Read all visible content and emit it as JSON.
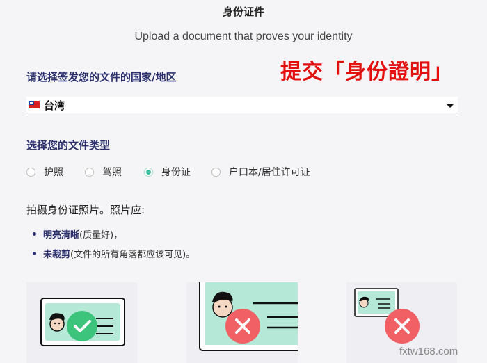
{
  "header": {
    "title": "身份证件",
    "subtitle": "Upload a document that proves your identity"
  },
  "annotation": "提交「身份證明」",
  "country": {
    "label": "请选择签发您的文件的国家/地区",
    "value": "台湾",
    "flag_icon": "taiwan-flag-icon"
  },
  "doc_type": {
    "label": "选择您的文件类型",
    "options": [
      "护照",
      "驾照",
      "身份证",
      "户口本/居住许可证"
    ],
    "selected": "身份证"
  },
  "photo_instructions": {
    "heading": "拍摄身份证照片。照片应:",
    "items": [
      {
        "bold": "明亮清晰",
        "rest": "(质量好)，"
      },
      {
        "bold": "未裁剪",
        "rest": "(文件的所有角落都应该可见)。"
      }
    ]
  },
  "examples": [
    {
      "status": "good",
      "icon": "check-icon"
    },
    {
      "status": "bad-cropped",
      "icon": "x-icon"
    },
    {
      "status": "bad-small",
      "icon": "x-icon"
    }
  ],
  "colors": {
    "accent": "#3dbfa0",
    "card_mint": "#b5e8d6",
    "good": "#3cc47c",
    "bad": "#f06065",
    "heading_blue": "#2b2f6b",
    "annotation_red": "#e31010"
  },
  "watermark": "fxtw168.com"
}
